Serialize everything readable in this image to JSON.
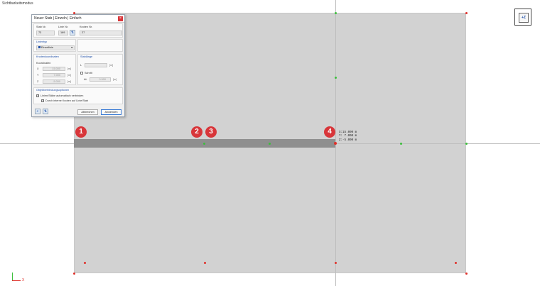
{
  "viewport": {
    "mode_label": "Sichtbarkeitsmodus",
    "view_cube_label": "+Z",
    "axis_x_label": "X",
    "markers": [
      "1",
      "2",
      "3",
      "4"
    ],
    "coordinates": [
      "X:15.000 m",
      "Y: 7.000 m",
      "Z:-5.000 m"
    ]
  },
  "dialog": {
    "title": "Neuer Stab | Einzeln | Einfach",
    "close_label": "×",
    "stab_nr_label": "Stab Nr.",
    "stab_nr_value": "73",
    "linie_nr_label": "Linie Nr.",
    "linie_nr_value": "169",
    "knoten_nr_label": "Knoten Nr.",
    "knoten_nr_value": "27",
    "linientyp_title": "Linientyp",
    "linientyp_value": "Einzellinie",
    "knotenkoordinaten_title": "Knotenkoordinaten",
    "koordinaten_label": "Koordinaten",
    "coord_rows": [
      {
        "axis": "X",
        "value": "15.000",
        "unit": "[m]"
      },
      {
        "axis": "Y",
        "value": "7.000",
        "unit": "[m]"
      },
      {
        "axis": "Z",
        "value": "-5.000",
        "unit": "[m]"
      }
    ],
    "stablaenge_title": "Stablänge",
    "length_label": "L",
    "length_unit": "[m]",
    "schritt_label": "Schritt",
    "delta_label": "ΔL",
    "delta_value": "0.500",
    "delta_unit": "[m]",
    "objektverbindung_title": "Objektverbindungsoptionen",
    "option_auto_connect": "Linien/Stäbe automatisch verbinden",
    "option_internal_nodes": "Durch interne Knoten auf Linie/Stab",
    "cancel_label": "Abbrechen",
    "apply_label": "Anwenden"
  }
}
